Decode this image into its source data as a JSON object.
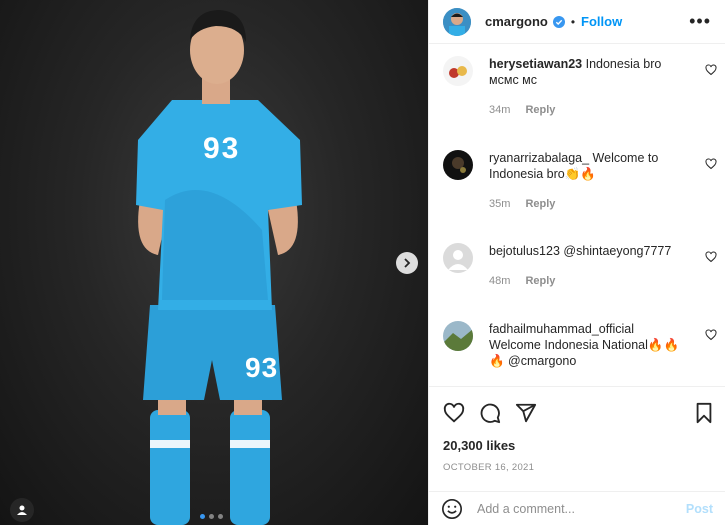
{
  "post": {
    "author": "cmargono",
    "follow_label": "Follow",
    "separator": "•",
    "more_label": "•••",
    "likes": "20,300 likes",
    "date": "OCTOBER 16, 2021",
    "carousel": {
      "total": 3,
      "active_index": 0
    },
    "jersey_number": "93"
  },
  "comments": [
    {
      "user": "herysetiawan23",
      "text": "Indonesia bro ᴍᴄᴍᴄ ᴍᴄ",
      "time": "34m",
      "reply_label": "Reply"
    },
    {
      "user": "ryanarrizabalaga_",
      "text": "Welcome to Indonesia bro👏🔥",
      "time": "35m",
      "reply_label": "Reply"
    },
    {
      "user": "bejotulus123",
      "text": "@shintaeyong7777",
      "time": "48m",
      "reply_label": "Reply"
    },
    {
      "user": "fadhailmuhammad_official",
      "text": "Welcome Indonesia National🔥🔥🔥 @cmargono",
      "time": "",
      "reply_label": ""
    }
  ],
  "composer": {
    "placeholder": "Add a comment...",
    "post_label": "Post"
  },
  "colors": {
    "accent": "#0095f6",
    "verified": "#3897f0",
    "post_disabled": "#b2dffc",
    "jersey": "#2fa6df"
  },
  "icons": [
    "verified-badge-icon",
    "more-options-icon",
    "heart-icon",
    "comment-icon",
    "share-icon",
    "bookmark-icon",
    "emoji-icon",
    "chevron-right-icon",
    "user-tag-icon"
  ]
}
